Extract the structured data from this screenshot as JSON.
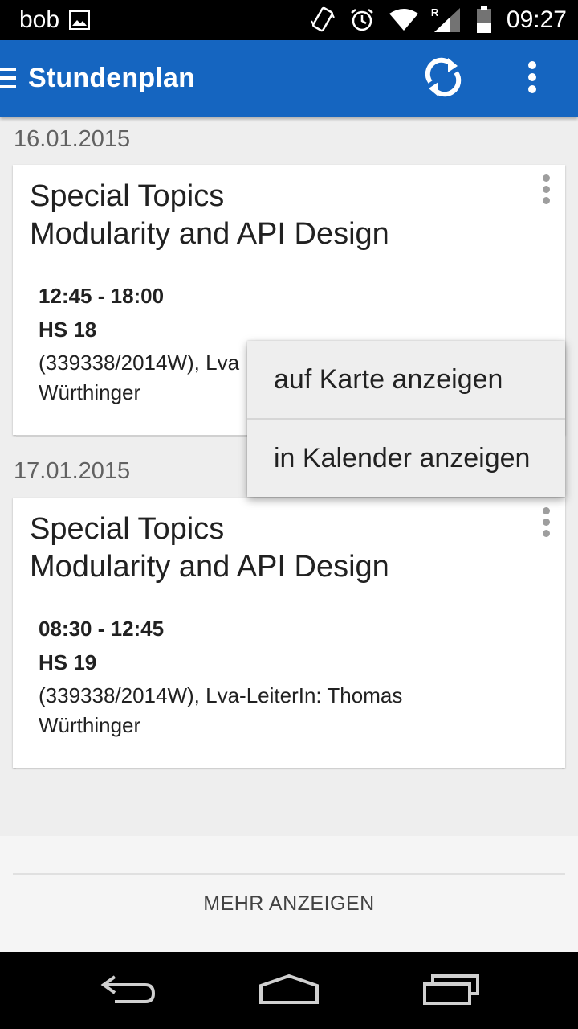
{
  "status_bar": {
    "carrier": "bob",
    "time": "09:27",
    "roaming_indicator": "R",
    "icons": [
      "image-icon",
      "vibrate-icon",
      "alarm-icon",
      "wifi-icon",
      "signal-icon",
      "battery-icon"
    ]
  },
  "app_bar": {
    "title": "Stundenplan",
    "icons": [
      "menu-icon",
      "refresh-icon",
      "more-vert-icon"
    ],
    "color": "#1565c0"
  },
  "schedule": [
    {
      "date": "16.01.2015",
      "title_line1": "Special Topics",
      "title_line2": "Modularity and API Design",
      "time": "12:45 - 18:00",
      "room": "HS 18",
      "description_visible": "(339338/2014W), Lva",
      "description_line2": "Würthinger"
    },
    {
      "date": "17.01.2015",
      "title_line1": "Special Topics",
      "title_line2": "Modularity and API Design",
      "time": "08:30 - 12:45",
      "room": "HS 19",
      "description": "(339338/2014W), Lva-LeiterIn: Thomas",
      "description_line2": "Würthinger"
    }
  ],
  "popup_menu": {
    "items": [
      "auf Karte anzeigen",
      "in Kalender anzeigen"
    ]
  },
  "footer": {
    "more_label": "MEHR ANZEIGEN"
  },
  "nav_bar": {
    "icons": [
      "back-icon",
      "home-icon",
      "recents-icon"
    ]
  }
}
